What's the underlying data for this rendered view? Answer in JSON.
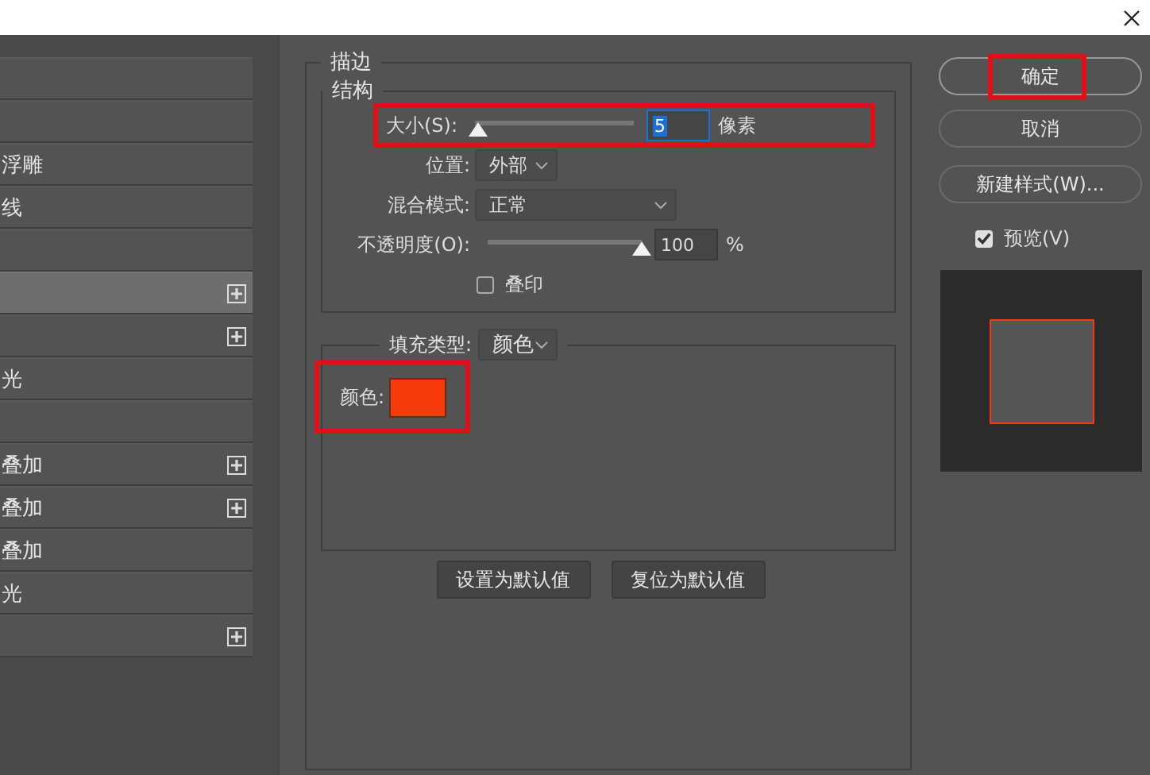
{
  "layers": [
    {
      "selected": false,
      "has_add": false
    },
    {
      "selected": false,
      "has_add": false
    },
    {
      "label": "浮雕",
      "selected": false,
      "has_add": false
    },
    {
      "label": "线",
      "selected": false,
      "has_add": false
    },
    {
      "selected": false,
      "has_add": false
    },
    {
      "selected": true,
      "has_add": true
    },
    {
      "selected": false,
      "has_add": true
    },
    {
      "label": "光",
      "selected": false,
      "has_add": false
    },
    {
      "selected": false,
      "has_add": false
    },
    {
      "label": "叠加",
      "selected": false,
      "has_add": true
    },
    {
      "label": "叠加",
      "selected": false,
      "has_add": true
    },
    {
      "label": "叠加",
      "selected": false,
      "has_add": false
    },
    {
      "label": "光",
      "selected": false,
      "has_add": false
    },
    {
      "selected": false,
      "has_add": true
    }
  ],
  "stroke": {
    "title": "描边",
    "structure": {
      "title": "结构",
      "size": {
        "label": "大小(S):",
        "level": 0.02,
        "value": "5",
        "unit": "像素",
        "highlight": true
      },
      "position": {
        "label": "位置:",
        "value": "外部"
      },
      "blend_mode": {
        "label": "混合模式:",
        "value": "正常"
      },
      "opacity": {
        "label": "不透明度(O):",
        "level": 1,
        "value": "100",
        "unit": "%"
      },
      "overprint": {
        "label": "叠印",
        "checked": false
      }
    },
    "fill": {
      "label": "填充类型:",
      "value": "颜色",
      "color_label": "颜色:",
      "color": "#f53a0c",
      "highlight": true
    }
  },
  "default_buttons": [
    "设置为默认值",
    "复位为默认值"
  ],
  "actions": [
    {
      "label": "确定",
      "highlight": true
    },
    {
      "label": "取消",
      "highlight": false
    },
    {
      "label": "新建样式(W)...",
      "highlight": false
    }
  ],
  "preview": {
    "label": "预览(V)",
    "checked": true
  }
}
